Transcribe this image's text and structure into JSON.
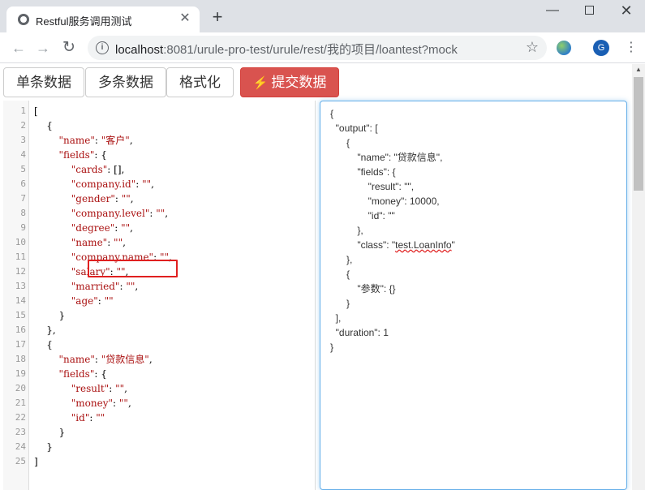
{
  "browser": {
    "tab_title": "Restful服务调用测试",
    "url_host": "localhost",
    "url_rest": ":8081/urule-pro-test/urule/rest/我的项目/loantest?mock",
    "avatar_letter": "G"
  },
  "buttons": {
    "single": "单条数据",
    "multi": "多条数据",
    "format": "格式化",
    "submit": "提交数据"
  },
  "editor": {
    "line_numbers": [
      "1",
      "2",
      "3",
      "4",
      "5",
      "6",
      "7",
      "8",
      "9",
      "10",
      "11",
      "12",
      "13",
      "14",
      "15",
      "16",
      "17",
      "18",
      "19",
      "20",
      "21",
      "22",
      "23",
      "24",
      "25"
    ],
    "lines": [
      "[",
      "    {",
      "        \"name\": \"客户\",",
      "        \"fields\": {",
      "            \"cards\": [],",
      "            \"company.id\": \"\",",
      "            \"gender\": \"\",",
      "            \"company.level\": \"\",",
      "            \"degree\": \"\",",
      "            \"name\": \"\",",
      "            \"company.name\": \"\",",
      "            \"salary\": \"\",",
      "            \"married\": \"\",",
      "            \"age\": \"\"",
      "        }",
      "    },",
      "    {",
      "        \"name\": \"贷款信息\",",
      "        \"fields\": {",
      "            \"result\": \"\",",
      "            \"money\": \"\",",
      "            \"id\": \"\"",
      "        }",
      "    }",
      "]"
    ]
  },
  "output": {
    "lines": [
      "{",
      "  \"output\": [",
      "      {",
      "          \"name\": \"贷款信息\",",
      "          \"fields\": {",
      "              \"result\": \"\",",
      "              \"money\": 10000,",
      "              \"id\": \"\"",
      "          },",
      "          \"class\": \"test.LoanInfo\"",
      "      },",
      "      {",
      "          \"参数\": {}",
      "      }",
      "  ],",
      "  \"duration\": 1",
      "}"
    ]
  },
  "colors": {
    "submit_bg": "#d9534f",
    "highlight": "#e02020",
    "focus_border": "#66afe9"
  }
}
